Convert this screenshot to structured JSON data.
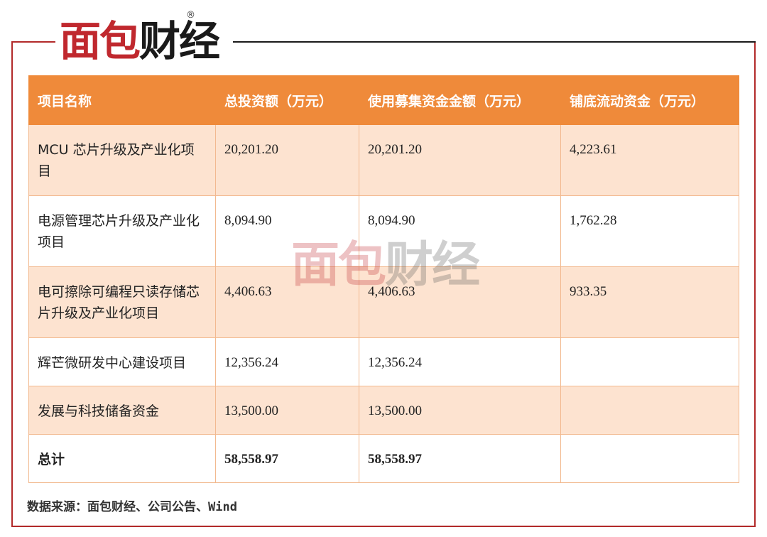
{
  "brand": {
    "logo_part1": "面包",
    "logo_part2": "财经",
    "registered": "®"
  },
  "table": {
    "headers": [
      "项目名称",
      "总投资额（万元）",
      "使用募集资金金额（万元）",
      "铺底流动资金（万元）"
    ],
    "rows": [
      [
        "MCU 芯片升级及产业化项目",
        "20,201.20",
        "20,201.20",
        "4,223.61"
      ],
      [
        "电源管理芯片升级及产业化项目",
        "8,094.90",
        "8,094.90",
        "1,762.28"
      ],
      [
        "电可擦除可编程只读存储芯片升级及产业化项目",
        "4,406.63",
        "4,406.63",
        "933.35"
      ],
      [
        "辉芒微研发中心建设项目",
        "12,356.24",
        "12,356.24",
        ""
      ],
      [
        "发展与科技储备资金",
        "13,500.00",
        "13,500.00",
        ""
      ],
      [
        "总计",
        "58,558.97",
        "58,558.97",
        ""
      ]
    ]
  },
  "source": "数据来源：面包财经、公司公告、Wind",
  "colors": {
    "header_bg": "#ef8a3a",
    "shade_row": "#fde3d0",
    "frame": "#b22a2a",
    "brand_red": "#c0282e"
  }
}
